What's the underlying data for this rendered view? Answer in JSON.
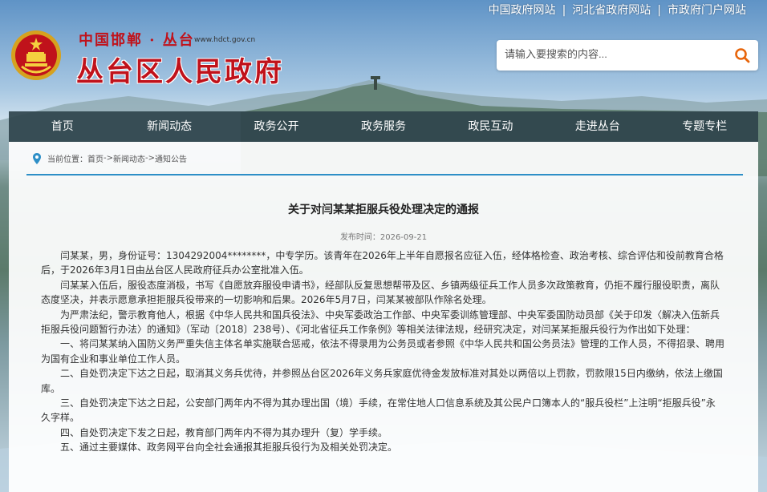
{
  "top_links": [
    "中国政府网站",
    "河北省政府网站",
    "市政府门户网站"
  ],
  "header": {
    "subtitle": "中国邯郸 · 丛台",
    "url": "www.hdct.gov.cn",
    "title": "丛台区人民政府"
  },
  "search": {
    "placeholder": "请输入要搜索的内容..."
  },
  "nav": [
    "首页",
    "新闻动态",
    "政务公开",
    "政务服务",
    "政民互动",
    "走进丛台",
    "专题专栏"
  ],
  "breadcrumb": {
    "prefix": "当前位置：",
    "items": [
      "首页",
      "新闻动态",
      "通知公告"
    ],
    "separator": "->"
  },
  "article": {
    "title": "关于对闫某某拒服兵役处理决定的通报",
    "date": "发布时间：2026-09-21",
    "paragraphs": [
      "闫某某，男，身份证号：1304292004********，中专学历。该青年在2026年上半年自愿报名应征入伍，经体格检查、政治考核、综合评估和役前教育合格后，于2026年3月1日由丛台区人民政府征兵办公室批准入伍。",
      "闫某某入伍后，服役态度消极，书写《自愿放弃服役申请书》，经部队反复思想帮带及区、乡镇两级征兵工作人员多次政策教育，仍拒不履行服役职责，离队态度坚决，并表示愿意承担拒服兵役带来的一切影响和后果。2026年5月7日，闫某某被部队作除名处理。",
      "为严肃法纪，警示教育他人，根据《中华人民共和国兵役法》、中央军委政治工作部、中央军委训练管理部、中央军委国防动员部《关于印发〈解决入伍新兵拒服兵役问题暂行办法〉的通知》（军动〔2018〕238号）、《河北省征兵工作条例》等相关法律法规，经研究决定，对闫某某拒服兵役行为作出如下处理：",
      "一、将闫某某纳入国防义务严重失信主体名单实施联合惩戒，依法不得录用为公务员或者参照《中华人民共和国公务员法》管理的工作人员，不得招录、聘用为国有企业和事业单位工作人员。",
      "二、自处罚决定下达之日起，取消其义务兵优待，并参照丛台区2026年义务兵家庭优待金发放标准对其处以两倍以上罚款，罚款限15日内缴纳，依法上缴国库。",
      "三、自处罚决定下达之日起，公安部门两年内不得为其办理出国（境）手续，在常住地人口信息系统及其公民户口簿本人的“服兵役栏”上注明“拒服兵役”永久字样。",
      "四、自处罚决定下发之日起，教育部门两年内不得为其办理升（复）学手续。",
      "五、通过主要媒体、政务网平台向全社会通报其拒服兵役行为及相关处罚决定。"
    ]
  },
  "colors": {
    "brand_red": "#c0121b",
    "nav_bg": "#2f444c",
    "accent_blue": "#2d8fc7",
    "search_icon": "#e8660c"
  },
  "icons": [
    "national-emblem-icon",
    "search-icon",
    "location-pin-icon"
  ]
}
